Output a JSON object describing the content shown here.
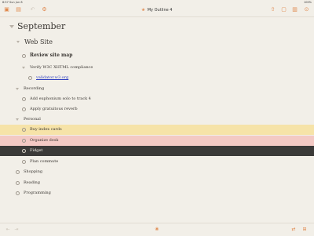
{
  "status_bar": {
    "time_date": "8:57   Sun Jun 8",
    "battery": "100%"
  },
  "toolbar": {
    "title": "My Outline 4",
    "icons": [
      "sidebar-icon",
      "outline-icon",
      "back-icon",
      "style-icon",
      "share-icon",
      "inspector-icon",
      "columns-icon",
      "settings-icon"
    ]
  },
  "outline": {
    "heading": "September",
    "web_site": "Web Site",
    "review_site_map": "Review site map",
    "verify_compliance": "Verify W3C XHTML compliance",
    "validator_link": "validator.w3.org",
    "recording": "Recording",
    "add_euphonium": "Add euphonium solo to track 4",
    "apply_reverb": "Apply gratuitous reverb",
    "personal": "Personal",
    "buy_index_cards": "Buy index cards",
    "organize_desk": "Organize desk",
    "fidget": "Fidget",
    "plan_commute": "Plan commute",
    "shopping": "Shopping",
    "reading": "Reading",
    "programming": "Programming"
  },
  "colors": {
    "accent": "#e0894e",
    "highlight_yellow": "#f6e3a8",
    "highlight_pink": "#f3c9c4",
    "highlight_dark": "#3b3a38",
    "link": "#3040c0"
  }
}
